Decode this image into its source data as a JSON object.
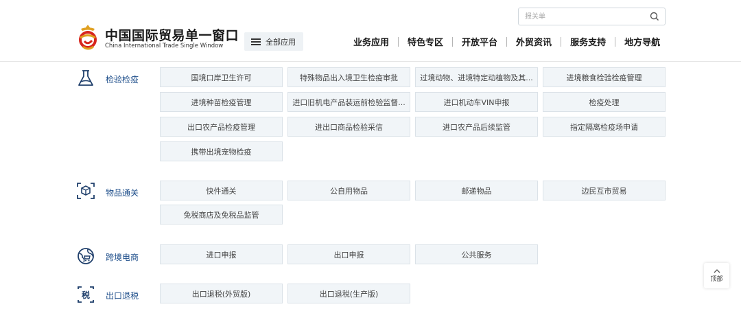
{
  "header": {
    "logo_cn": "中国国际贸易单一窗口",
    "logo_en": "China International Trade Single Window",
    "all_apps_label": "全部应用",
    "search_placeholder": "报关单",
    "nav": [
      "业务应用",
      "特色专区",
      "开放平台",
      "外贸资讯",
      "服务支持",
      "地方导航"
    ]
  },
  "categories": [
    {
      "label": "检验检疫",
      "icon": "flask-icon",
      "items": [
        "国境口岸卫生许可",
        "特殊物品出入境卫生检疫审批",
        "过境动物、进境特定动植物及其...",
        "进境粮食检验检疫管理",
        "进境种苗检疫管理",
        "进口旧机电产品装运前检验监督...",
        "进口机动车VIN申报",
        "检疫处理",
        "出口农产品检疫管理",
        "进出口商品检验采信",
        "进口农产品后续监管",
        "指定隔离检疫场申请",
        "携带出境宠物检疫"
      ]
    },
    {
      "label": "物品通关",
      "icon": "package-scan-icon",
      "items": [
        "快件通关",
        "公自用物品",
        "邮递物品",
        "边民互市贸易",
        "免税商店及免税品监管"
      ]
    },
    {
      "label": "跨境电商",
      "icon": "ecommerce-icon",
      "items": [
        "进口申报",
        "出口申报",
        "公共服务"
      ]
    },
    {
      "label": "出口退税",
      "icon": "tax-icon",
      "items": [
        "出口退税(外贸版)",
        "出口退税(生产版)"
      ]
    }
  ],
  "to_top_label": "顶部",
  "colors": {
    "category_label": "#1f4f8b",
    "tile_bg": "#f1f5f8",
    "tile_border": "#dbe2e8",
    "logo_red": "#d7261e",
    "logo_gold": "#e0a020"
  }
}
